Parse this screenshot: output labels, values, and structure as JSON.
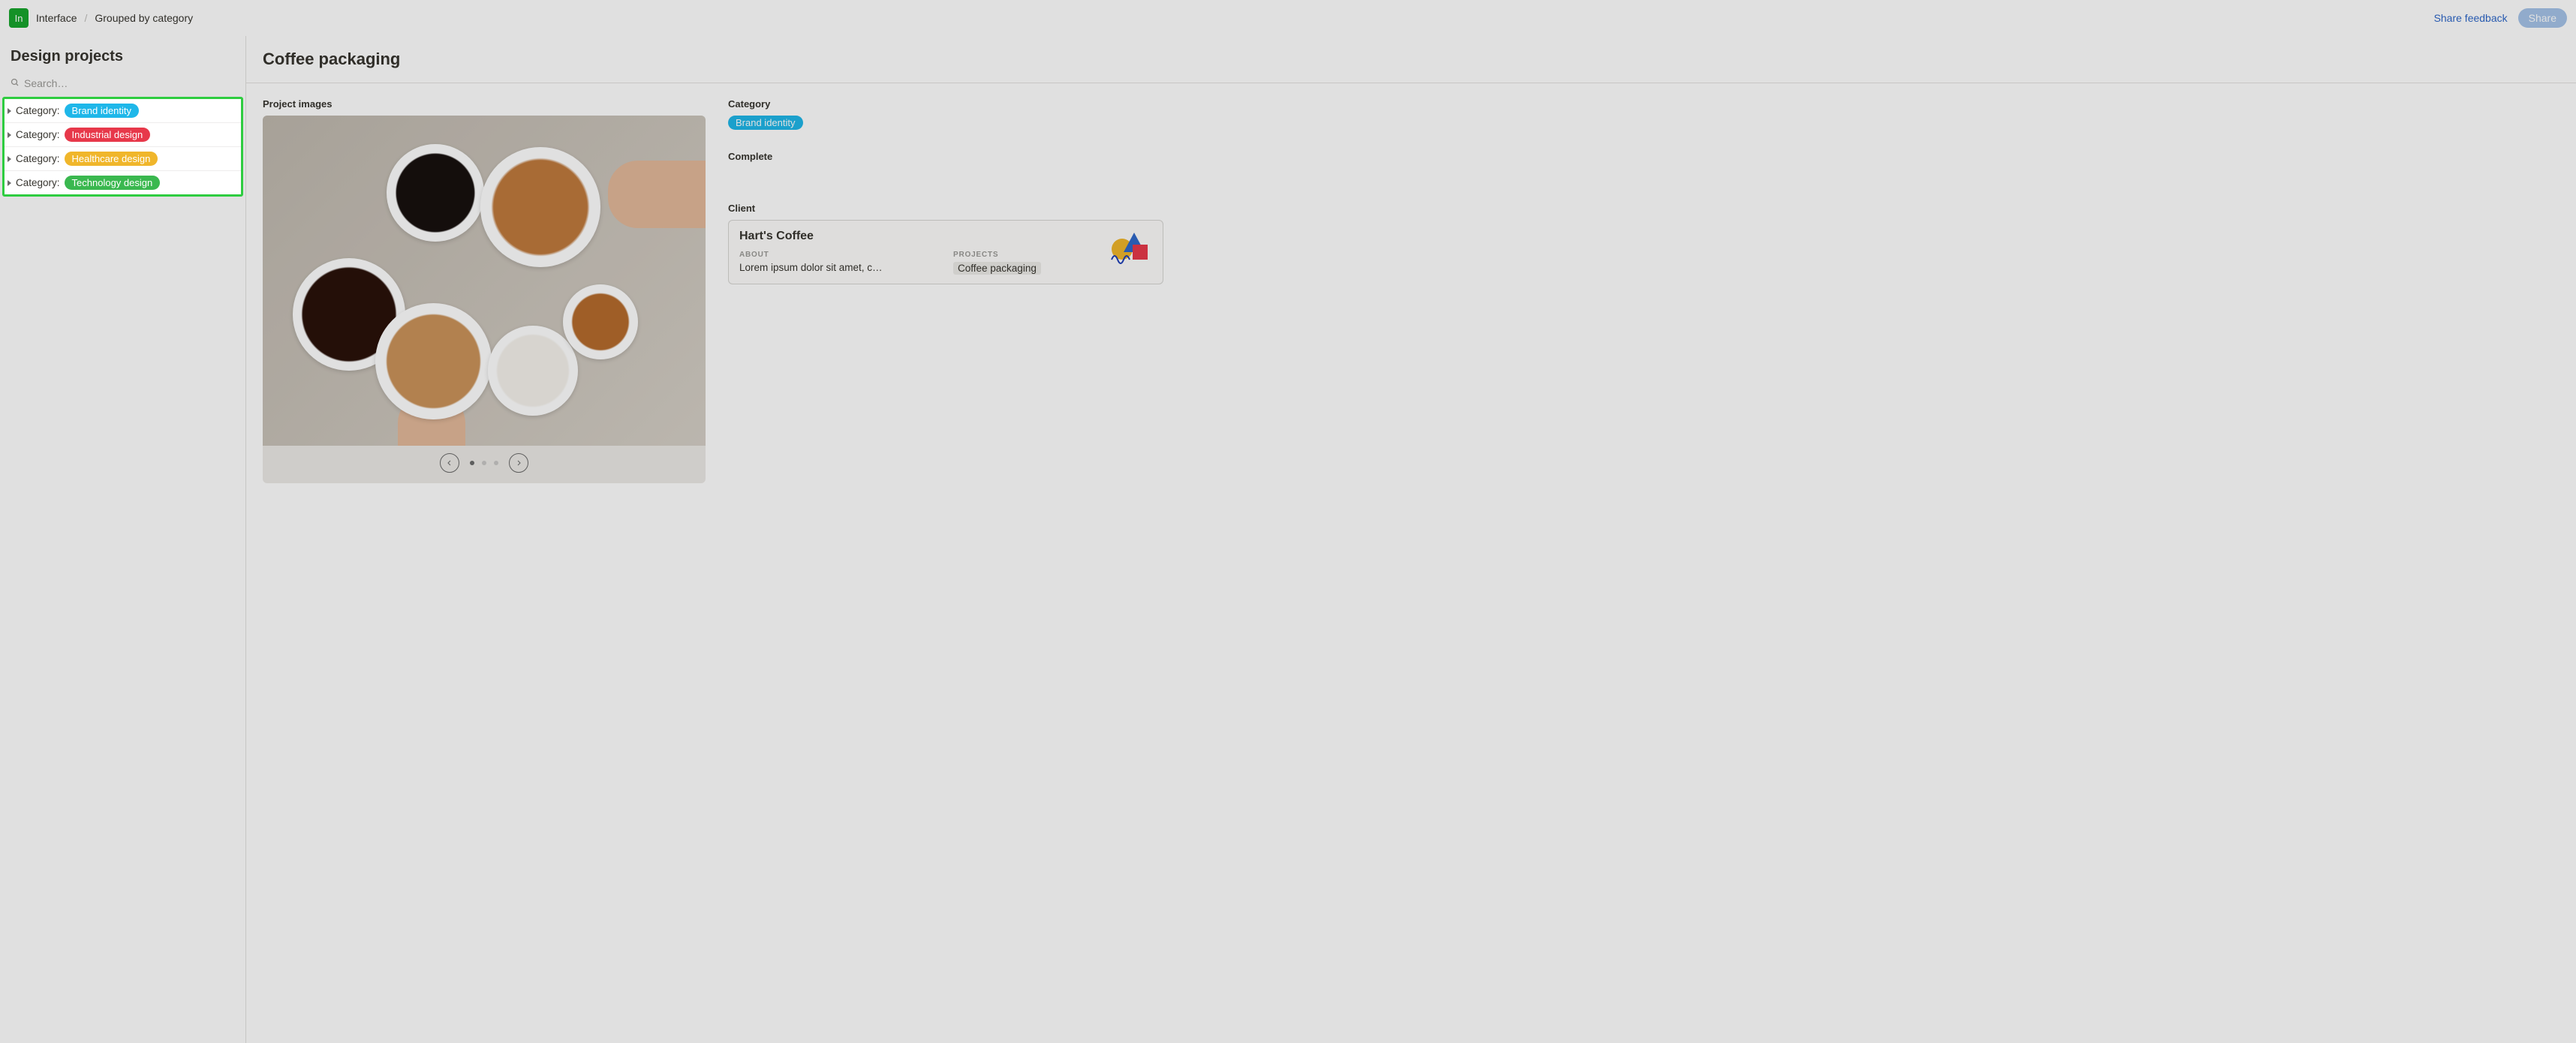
{
  "workspace": {
    "icon_text": "In"
  },
  "breadcrumbs": {
    "root": "Interface",
    "current": "Grouped by category"
  },
  "header_actions": {
    "feedback": "Share feedback",
    "share": "Share"
  },
  "sidebar": {
    "title": "Design projects",
    "search_placeholder": "Search…",
    "group_prefix": "Category:",
    "groups": [
      {
        "label": "Brand identity",
        "color": "#1fb7e9"
      },
      {
        "label": "Industrial design",
        "color": "#e7384a"
      },
      {
        "label": "Healthcare design",
        "color": "#f0b62b"
      },
      {
        "label": "Technology design",
        "color": "#3ab84f"
      }
    ]
  },
  "page": {
    "title": "Coffee packaging",
    "images_label": "Project images",
    "category_label": "Category",
    "category_tag": "Brand identity",
    "category_tag_color": "#1fb7e9",
    "complete_label": "Complete",
    "client_label": "Client",
    "client": {
      "name": "Hart's Coffee",
      "about_heading": "ABOUT",
      "about_text": "Lorem ipsum dolor sit amet, c…",
      "projects_heading": "PROJECTS",
      "project_chip": "Coffee packaging"
    }
  }
}
